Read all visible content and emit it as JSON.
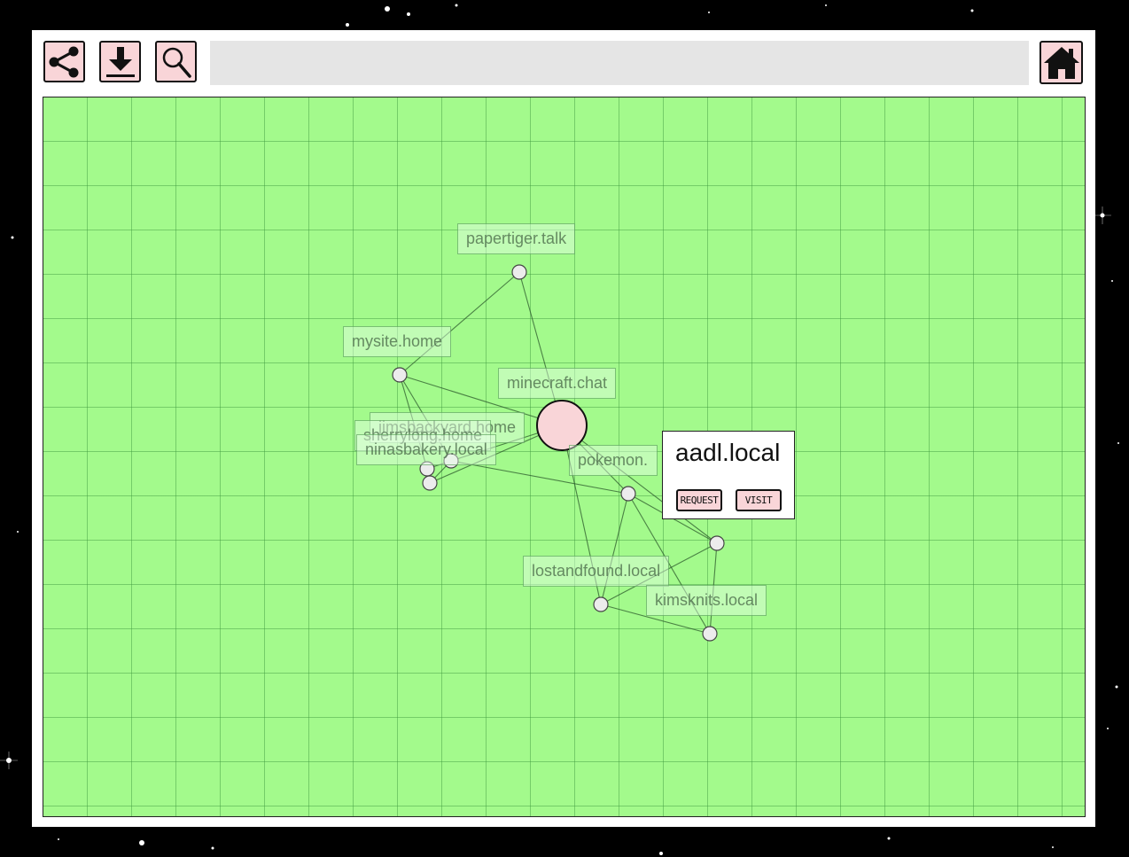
{
  "toolbar": {
    "buttons": [
      {
        "name": "share",
        "icon": "share-icon"
      },
      {
        "name": "download",
        "icon": "download-icon"
      },
      {
        "name": "search",
        "icon": "search-icon"
      }
    ],
    "address_value": "",
    "home_icon": "home-icon"
  },
  "colors": {
    "canvas_background": "#a3fa8c",
    "grid_line": "#6fbf68",
    "button_fill": "#f9d5d8",
    "selected_node_fill": "#f9d5d8",
    "node_fill": "#ececec"
  },
  "graph": {
    "nodes": [
      {
        "id": "papertiger",
        "label": "papertiger.talk"
      },
      {
        "id": "mysite",
        "label": "mysite.home"
      },
      {
        "id": "minecraft",
        "label": "minecraft.chat"
      },
      {
        "id": "jimsbackyard",
        "label": "jimsbackyard.home"
      },
      {
        "id": "sherrylong",
        "label": "sherrylong.home"
      },
      {
        "id": "ninasbakery",
        "label": "ninasbakery.local"
      },
      {
        "id": "aadl",
        "label": "aadl.local",
        "selected": true
      },
      {
        "id": "pokemon",
        "label": "pokemon."
      },
      {
        "id": "lostandfound",
        "label": "lostandfound.local"
      },
      {
        "id": "kimsknits",
        "label": "kimsknits.local"
      },
      {
        "id": "unnamed_right",
        "label": ""
      }
    ],
    "edges": [
      [
        "papertiger",
        "mysite"
      ],
      [
        "papertiger",
        "aadl"
      ],
      [
        "mysite",
        "aadl"
      ],
      [
        "mysite",
        "jimsbackyard"
      ],
      [
        "mysite",
        "sherrylong"
      ],
      [
        "jimsbackyard",
        "sherrylong"
      ],
      [
        "jimsbackyard",
        "ninasbakery"
      ],
      [
        "sherrylong",
        "ninasbakery"
      ],
      [
        "jimsbackyard",
        "pokemon"
      ],
      [
        "aadl",
        "jimsbackyard"
      ],
      [
        "aadl",
        "ninasbakery"
      ],
      [
        "aadl",
        "pokemon"
      ],
      [
        "aadl",
        "unnamed_right"
      ],
      [
        "aadl",
        "lostandfound"
      ],
      [
        "pokemon",
        "lostandfound"
      ],
      [
        "pokemon",
        "kimsknits"
      ],
      [
        "pokemon",
        "unnamed_right"
      ],
      [
        "lostandfound",
        "unnamed_right"
      ],
      [
        "lostandfound",
        "kimsknits"
      ],
      [
        "unnamed_right",
        "kimsknits"
      ]
    ]
  },
  "popup": {
    "title": "aadl.local",
    "request_label": "REQUEST",
    "visit_label": "VISIT"
  }
}
